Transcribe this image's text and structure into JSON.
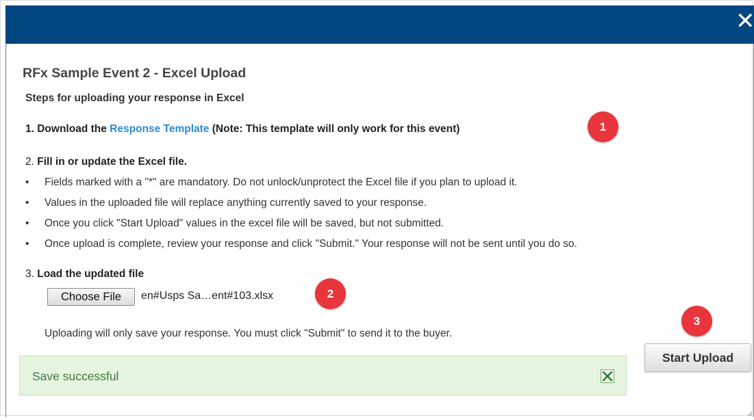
{
  "window": {
    "close_glyph": "✕",
    "close_icon": "close-icon"
  },
  "dialog": {
    "title": "RFx Sample Event 2 - Excel Upload",
    "steps_heading": "Steps for uploading your response in Excel",
    "step1": {
      "prefix": "1. Download the ",
      "link": "Response Template",
      "suffix": " (Note: This template will only work for this event)"
    },
    "step2": {
      "number": "2. ",
      "label": "Fill in or update the Excel file."
    },
    "bullets": [
      "Fields marked with a \"*\" are mandatory. Do not unlock/unprotect the Excel file if you plan to upload it.",
      "Values in the uploaded file will replace anything currently saved to your response.",
      "Once you click \"Start Upload\" values in the excel file will be saved, but not submitted.",
      "Once upload is complete, review your response and click \"Submit.\" Your response will not be sent until you do so."
    ],
    "bullet_glyph": "•",
    "step3": {
      "number": "3. ",
      "label": "Load the updated file"
    },
    "file_input": {
      "button_label": "Choose File",
      "file_name": "en#Usps Sa…ent#103.xlsx"
    },
    "upload_note": "Uploading will only save your response. You must click \"Submit\" to send it to the buyer.",
    "start_upload_label": "Start Upload",
    "alert": {
      "message": "Save successful",
      "close_icon": "close-icon"
    }
  },
  "annotations": {
    "marker1": "1",
    "marker2": "2",
    "marker3": "3"
  },
  "colors": {
    "titlebar": "#004680",
    "link": "#2b8ad6",
    "success_bg": "#e6f5df",
    "success_text": "#3d7a3d",
    "marker": "#e8363c"
  }
}
